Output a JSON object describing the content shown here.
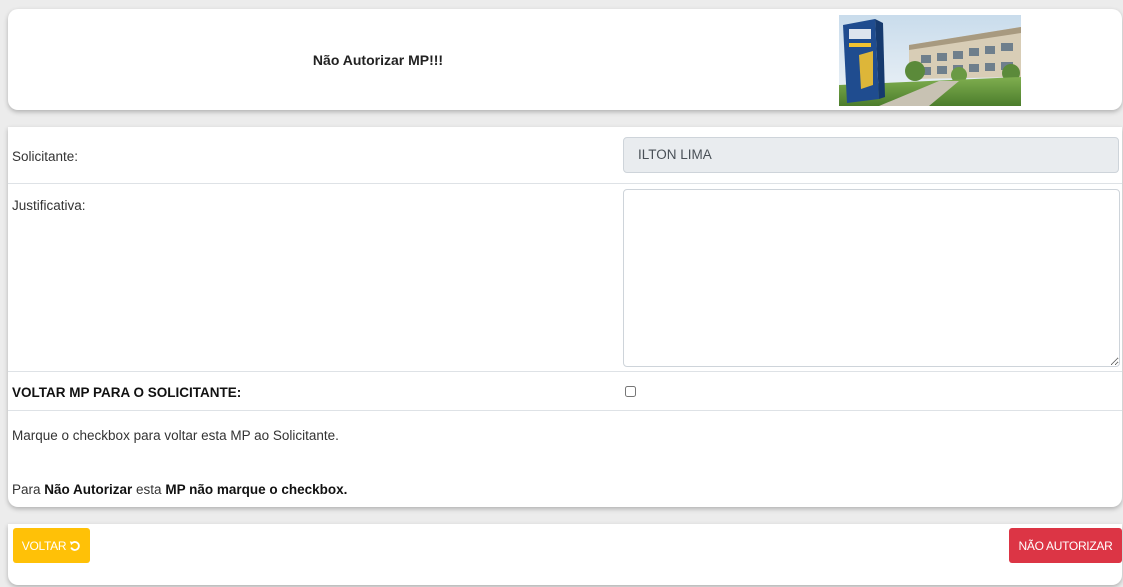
{
  "header": {
    "title": "Não Autorizar MP!!!"
  },
  "form": {
    "solicitante_label": "Solicitante:",
    "solicitante_value": "ILTON LIMA",
    "justificativa_label": "Justificativa:",
    "justificativa_value": "",
    "voltar_label": "VOLTAR MP PARA O SOLICITANTE:",
    "voltar_checked": false,
    "info_line1": "Marque o checkbox para voltar esta MP ao Solicitante.",
    "info_line2": {
      "part1": "Para ",
      "bold1": "Não Autorizar",
      "part2": " esta ",
      "bold2": "MP não marque o checkbox."
    }
  },
  "buttons": {
    "back_label": "VOLTAR",
    "back_icon": "undo-icon",
    "deny_label": "NÃO AUTORIZAR"
  },
  "colors": {
    "warning": "#ffc107",
    "danger": "#dc3545",
    "readonly_bg": "#e9ecef"
  }
}
